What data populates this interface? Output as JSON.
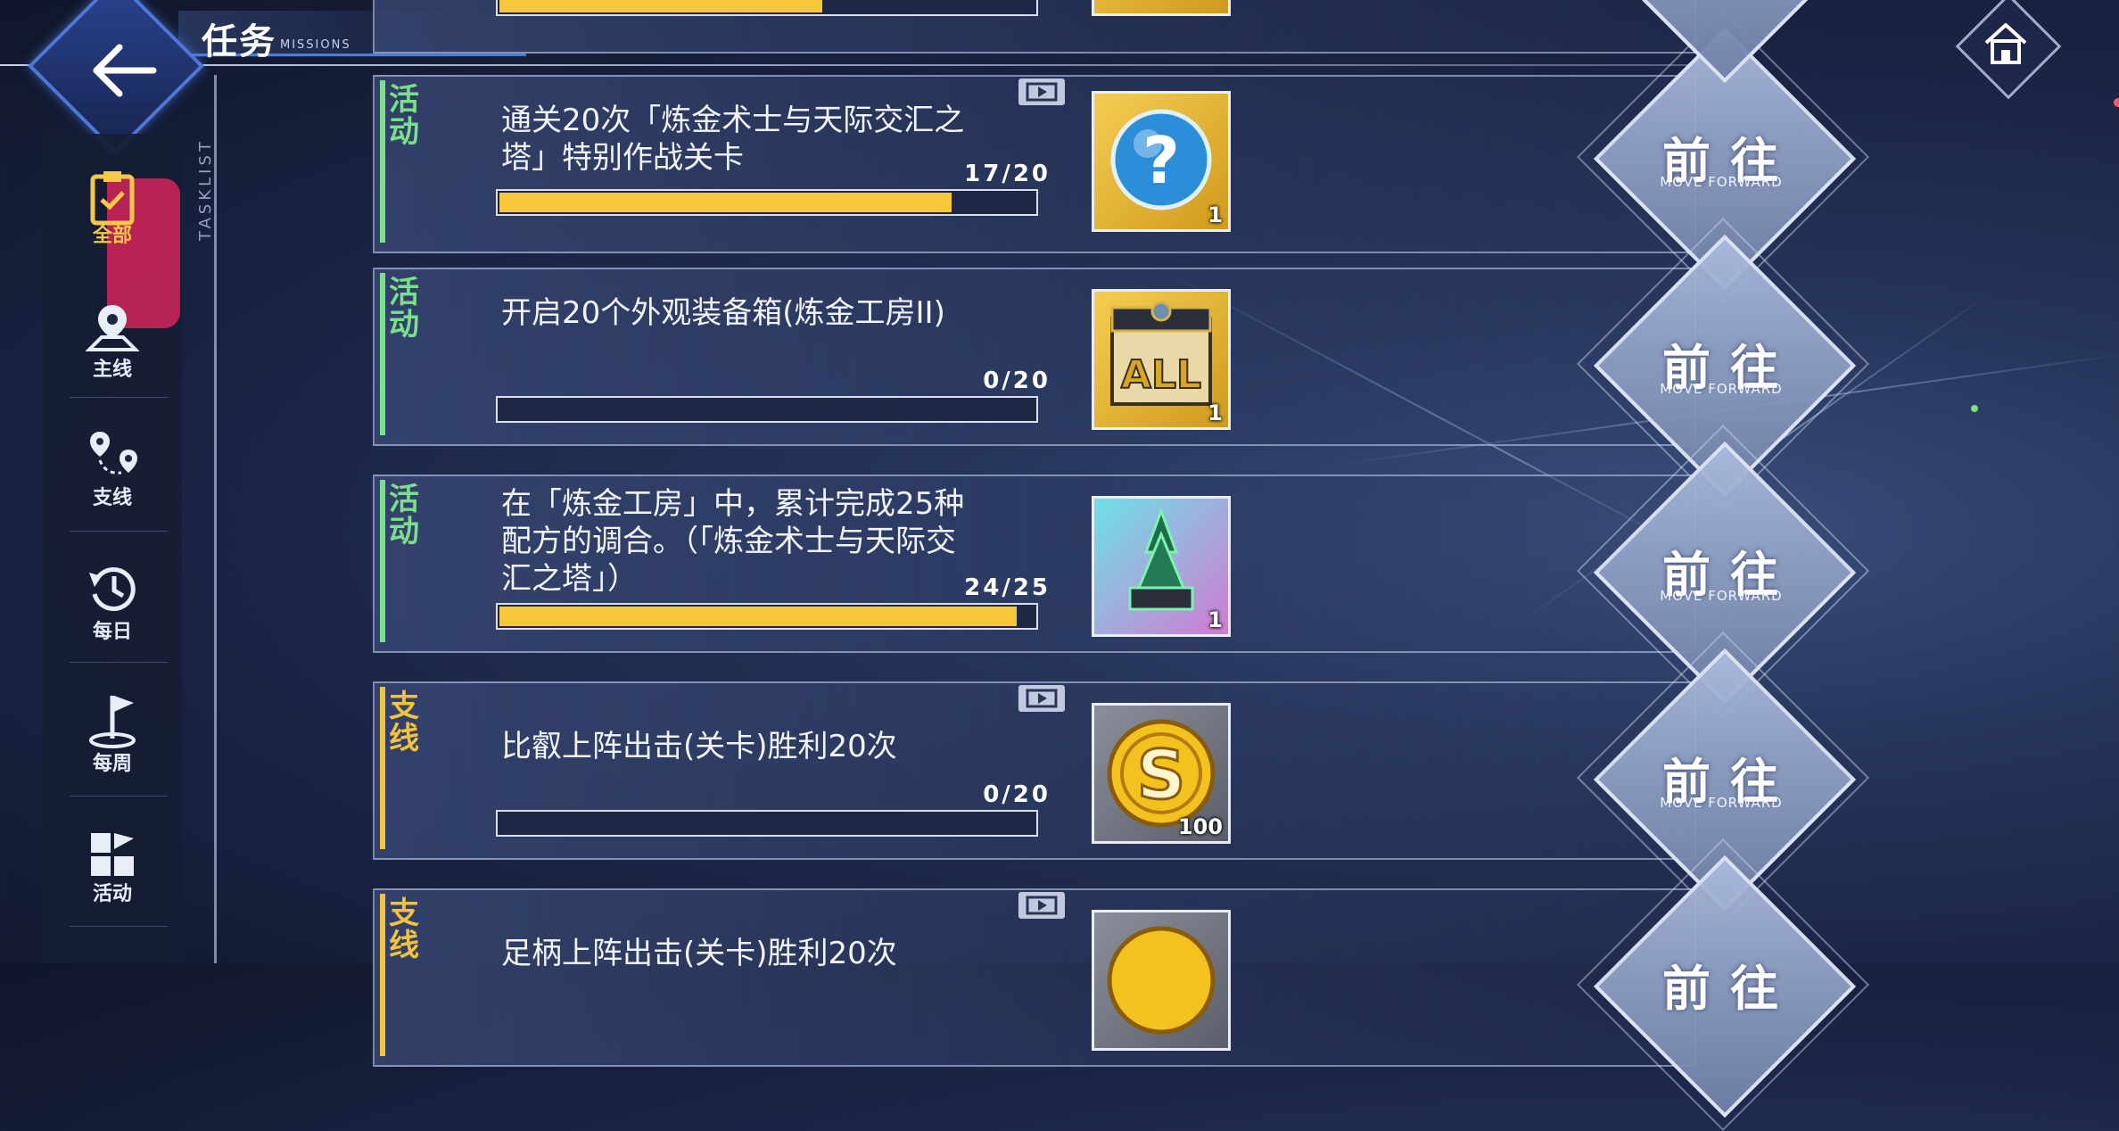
{
  "header": {
    "title": "任务",
    "subtitle": "MISSIONS",
    "back_icon": "back-arrow-icon",
    "home_icon": "home-icon"
  },
  "sidebar": {
    "vertical_label": "TASKLIST",
    "items": [
      {
        "label": "全部",
        "icon": "clipboard-icon",
        "active": true
      },
      {
        "label": "主线",
        "icon": "map-pin-icon",
        "active": false
      },
      {
        "label": "支线",
        "icon": "route-pins-icon",
        "active": false
      },
      {
        "label": "每日",
        "icon": "history-clock-icon",
        "active": false
      },
      {
        "label": "每周",
        "icon": "flag-icon",
        "active": false
      },
      {
        "label": "活动",
        "icon": "grid-flag-icon",
        "active": false
      }
    ]
  },
  "missions": [
    {
      "tag": "活动",
      "tag_color": "#7be08a",
      "description": "通关20次「炼金术士与天际交汇之塔」特别作战关卡",
      "progress_text": "17/20",
      "progress": 0.85,
      "reward_icon": "mystery-orb-icon",
      "reward_count": "1",
      "has_video": true,
      "go_label": "前往",
      "go_sub": "MOVE FORWARD"
    },
    {
      "tag": "活动",
      "tag_color": "#7be08a",
      "description": "开启20个外观装备箱(炼金工房II)",
      "progress_text": "0/20",
      "progress": 0,
      "reward_icon": "all-box-icon",
      "reward_count": "1",
      "has_video": false,
      "go_label": "前往",
      "go_sub": "MOVE FORWARD"
    },
    {
      "tag": "活动",
      "tag_color": "#7be08a",
      "description": "在「炼金工房」中，累计完成25种配方的调合。（「炼金术士与天际交汇之塔」）",
      "progress_text": "24/25",
      "progress": 0.96,
      "reward_icon": "green-tower-icon",
      "reward_count": "1",
      "has_video": false,
      "go_label": "前往",
      "go_sub": "MOVE FORWARD"
    },
    {
      "tag": "支线",
      "tag_color": "#f3c23f",
      "description": "比叡上阵出击(关卡)胜利20次",
      "progress_text": "0/20",
      "progress": 0,
      "reward_icon": "gold-coin-icon",
      "reward_count": "100",
      "has_video": true,
      "go_label": "前往",
      "go_sub": "MOVE FORWARD"
    },
    {
      "tag": "支线",
      "tag_color": "#f3c23f",
      "description": "足柄上阵出击(关卡)胜利20次",
      "progress_text": "",
      "progress": 0,
      "reward_icon": "gold-coin-icon",
      "reward_count": "",
      "has_video": true,
      "go_label": "前往",
      "go_sub": "MOVE FORWARD"
    }
  ]
}
